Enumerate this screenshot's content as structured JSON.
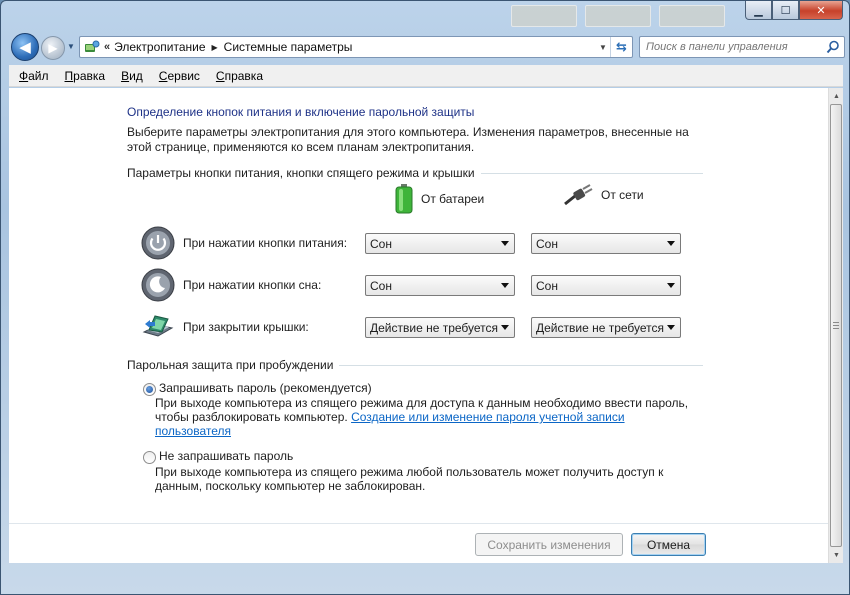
{
  "window": {
    "caption": {
      "minimize": "▁",
      "maximize": "☐",
      "close": "✕"
    }
  },
  "address_bar": {
    "prefix": "«",
    "crumbs": [
      "Электропитание",
      "Системные параметры"
    ]
  },
  "search": {
    "placeholder": "Поиск в панели управления"
  },
  "menu": {
    "items": [
      {
        "ul": "Ф",
        "rest": "айл"
      },
      {
        "ul": "П",
        "rest": "равка"
      },
      {
        "ul": "В",
        "rest": "ид"
      },
      {
        "ul": "С",
        "rest": "ервис"
      },
      {
        "ul": "С",
        "rest": "правка"
      }
    ]
  },
  "page": {
    "title": "Определение кнопок питания и включение парольной защиты",
    "description": "Выберите параметры электропитания для этого компьютера. Изменения параметров, внесенные на этой странице, применяются ко всем планам электропитания."
  },
  "buttons_section": {
    "heading": "Параметры кнопки питания, кнопки спящего режима и крышки",
    "col_battery": "От батареи",
    "col_ac": "От сети",
    "rows": [
      {
        "label": "При нажатии кнопки питания:",
        "icon": "power-button-icon",
        "battery": "Сон",
        "ac": "Сон"
      },
      {
        "label": "При нажатии кнопки сна:",
        "icon": "sleep-button-icon",
        "battery": "Сон",
        "ac": "Сон"
      },
      {
        "label": "При закрытии крышки:",
        "icon": "laptop-lid-icon",
        "battery": "Действие не требуется",
        "ac": "Действие не требуется"
      }
    ]
  },
  "password_section": {
    "heading": "Парольная защита при пробуждении",
    "options": [
      {
        "label": "Запрашивать пароль (рекомендуется)",
        "selected": true,
        "desc_line1": "При выходе компьютера из спящего режима для доступа к данным необходимо ввести пароль,",
        "desc_line2": "чтобы разблокировать компьютер.",
        "link_line1": "Создание или изменение пароля учетной записи",
        "link_line2": "пользователя"
      },
      {
        "label": "Не запрашивать пароль",
        "selected": false,
        "desc_line1": "При выходе компьютера из спящего режима любой пользователь может получить доступ к",
        "desc_line2": "данным, поскольку компьютер не заблокирован."
      }
    ]
  },
  "footer": {
    "save": "Сохранить изменения",
    "cancel": "Отмена"
  },
  "colors": {
    "title": "#1e3287",
    "link": "#0b66c6",
    "frame": "#a9c4e0"
  }
}
